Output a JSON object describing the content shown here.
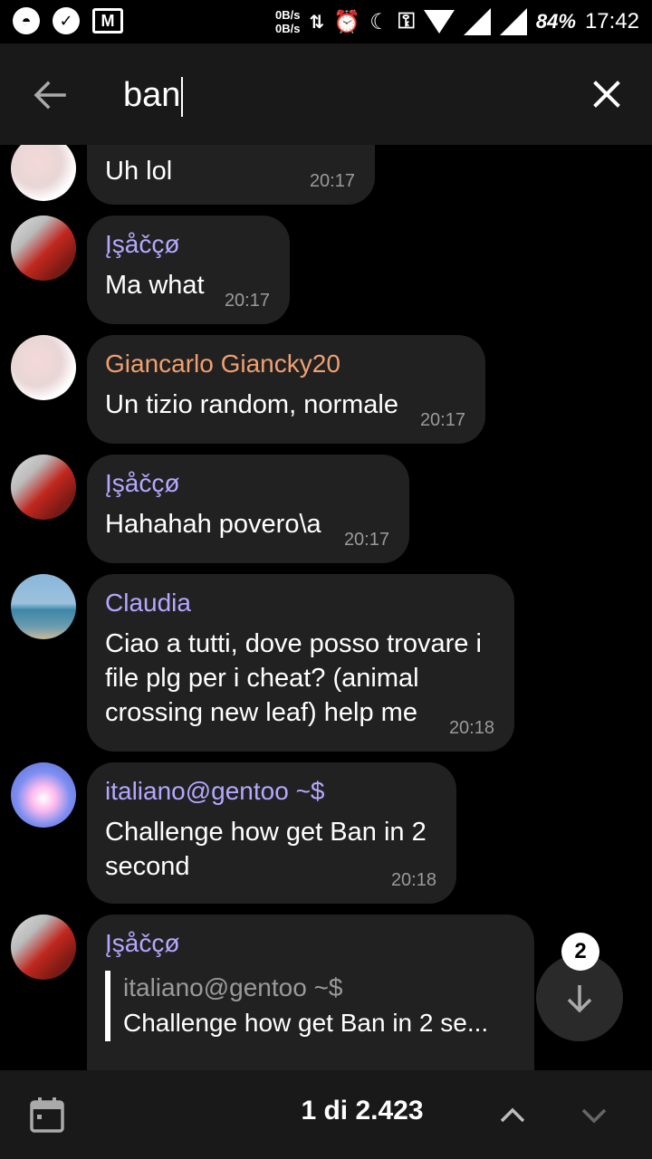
{
  "status_bar": {
    "net_up": "0B/s",
    "net_down": "0B/s",
    "battery": "84%",
    "time": "17:42",
    "icons": [
      "circle-app-icon",
      "check-circle-icon",
      "gmail-icon",
      "data-transfer-icon",
      "alarm-icon",
      "moon-icon",
      "key-icon",
      "wifi-icon",
      "signal-icon",
      "signal-icon"
    ]
  },
  "search": {
    "query": "ban",
    "back_icon": "arrow-left-icon",
    "close_icon": "close-icon"
  },
  "messages": [
    {
      "sender": "",
      "sender_color": "",
      "text": "Uh lol",
      "time": "20:17",
      "avatar": "avatar-red"
    },
    {
      "sender": "Įşåčçø",
      "sender_color": "#b4a8ff",
      "text": "Ma what",
      "time": "20:17",
      "avatar": "avatar-isacco"
    },
    {
      "sender": "Giancarlo Giancky20",
      "sender_color": "#f0a070",
      "text": "Un tizio random, normale",
      "time": "20:17",
      "avatar": "avatar-red"
    },
    {
      "sender": "Įşåčçø",
      "sender_color": "#b4a8ff",
      "text": "Hahahah povero\\a",
      "time": "20:17",
      "avatar": "avatar-isacco"
    },
    {
      "sender": "Claudia",
      "sender_color": "#b4a8ff",
      "text": "Ciao a tutti, dove posso trovare i file plg per i cheat?  (animal crossing new leaf) help me",
      "time": "20:18",
      "avatar": "avatar-sea"
    },
    {
      "sender": "italiano@gentoo ~$",
      "sender_color": "#b4a8ff",
      "text": "Challenge how get Ban in 2 second",
      "time": "20:18",
      "avatar": "avatar-anime"
    },
    {
      "sender": "Įşåčçø",
      "sender_color": "#b4a8ff",
      "reply_name": "italiano@gentoo ~$",
      "reply_text": "Challenge how get Ban in 2 se...",
      "avatar": "avatar-isacco"
    }
  ],
  "scroll_fab": {
    "badge_count": "2",
    "icon": "arrow-down-icon"
  },
  "bottom_bar": {
    "calendar_icon": "calendar-icon",
    "counter": "1 di 2.423",
    "up_icon": "chevron-up-icon",
    "down_icon": "chevron-down-icon"
  }
}
